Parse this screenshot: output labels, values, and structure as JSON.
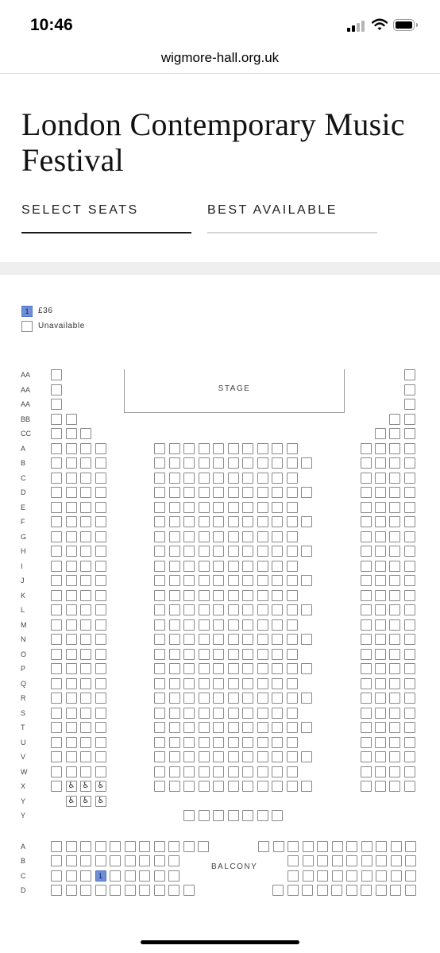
{
  "status_bar": {
    "time": "10:46",
    "signal_icon": "cellular-signal-icon",
    "wifi_icon": "wifi-icon",
    "battery_icon": "battery-icon"
  },
  "browser": {
    "url": "wigmore-hall.org.uk"
  },
  "event": {
    "title": "London Contemporary Music Festival"
  },
  "tabs": [
    {
      "label": "SELECT SEATS",
      "active": true
    },
    {
      "label": "BEST AVAILABLE",
      "active": false
    }
  ],
  "legend": {
    "price_badge": "1",
    "price_label": "£36",
    "unavailable_label": "Unavailable"
  },
  "seating": {
    "stage_label": "STAGE",
    "balcony_label": "BALCONY",
    "accessible_icon": "wheelchair-icon",
    "available_seat_label": "1",
    "stalls_rows": [
      "AA",
      "AA",
      "AA",
      "BB",
      "CC",
      "A",
      "B",
      "C",
      "D",
      "E",
      "F",
      "G",
      "H",
      "I",
      "J",
      "K",
      "L",
      "M",
      "N",
      "O",
      "P",
      "Q",
      "R",
      "S",
      "T",
      "U",
      "V",
      "W",
      "X",
      "Y",
      "Y"
    ],
    "balcony_rows": [
      "A",
      "B",
      "C",
      "D"
    ]
  },
  "colors": {
    "available_seat": "#6e8fd8",
    "tab_active_underline": "#1a1a1a",
    "tab_inactive_underline": "#d6d6d6"
  }
}
